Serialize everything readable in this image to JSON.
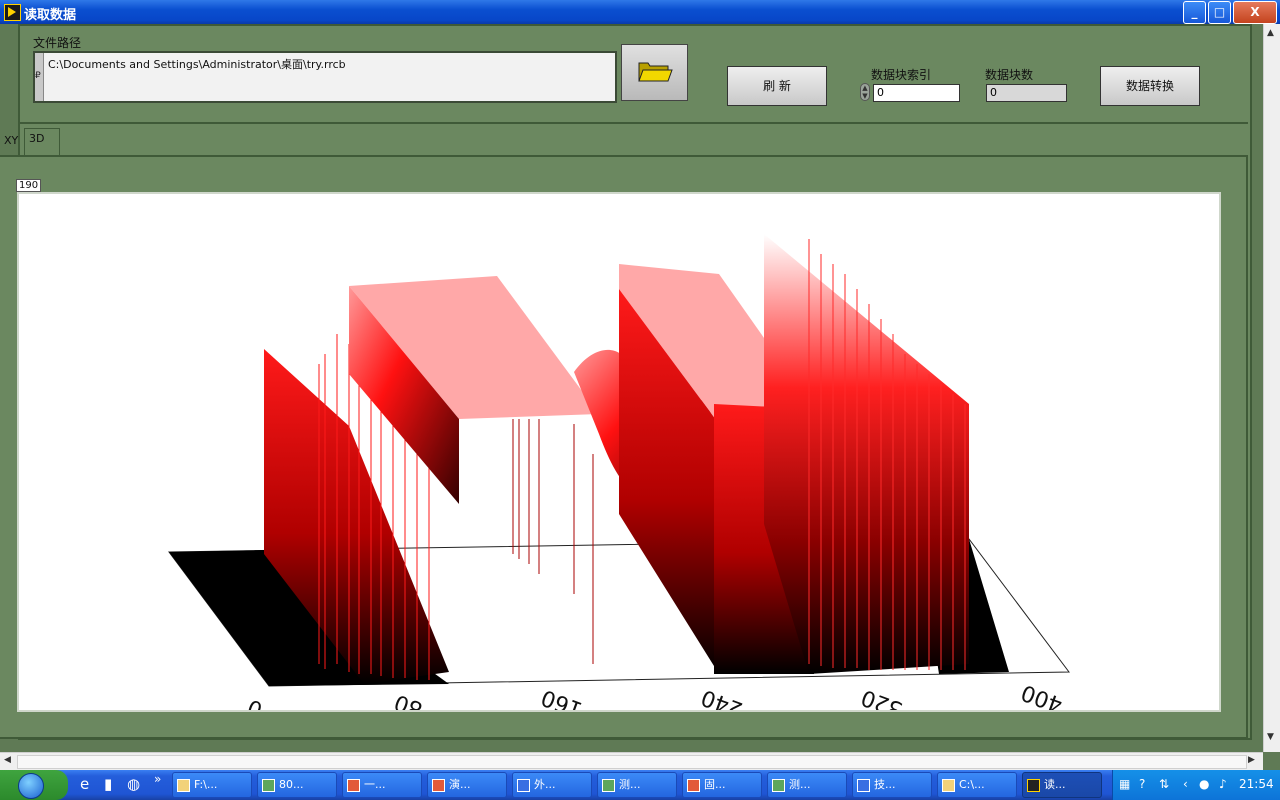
{
  "window": {
    "title": "读取数据",
    "controls": [
      "_",
      "□",
      "X"
    ]
  },
  "controls": {
    "file_path_label": "文件路径",
    "file_path_value": "C:\\Documents and Settings\\Administrator\\桌面\\try.rrcb",
    "path_strip_glyph": "₽",
    "refresh_label": "刷  新",
    "block_index_label": "数据块索引",
    "block_index_value": "0",
    "block_count_label": "数据块数",
    "block_count_value": "0",
    "convert_label": "数据转换"
  },
  "tabs": [
    {
      "label": "XY",
      "active": false
    },
    {
      "label": "3D",
      "active": true
    }
  ],
  "graph": {
    "label": "190",
    "axis_ticks": [
      "0",
      "80",
      "160",
      "240",
      "320",
      "400"
    ]
  },
  "colors": {
    "panel": "#6b8860",
    "surface_peak": "#ff0000",
    "surface_top": "#ffaaaa",
    "surface_base": "#000000"
  },
  "taskbar": {
    "quick_launch": [
      "ie-icon",
      "desktop-icon",
      "media-icon"
    ],
    "chevron": "»",
    "tasks": [
      {
        "label": "F:\\...",
        "icon": "folder-icon"
      },
      {
        "label": "80...",
        "icon": "doc-icon"
      },
      {
        "label": "一...",
        "icon": "ppt-icon"
      },
      {
        "label": "演...",
        "icon": "ppt-icon"
      },
      {
        "label": "外...",
        "icon": "word-icon"
      },
      {
        "label": "测...",
        "icon": "doc-icon"
      },
      {
        "label": "固...",
        "icon": "ppt-icon"
      },
      {
        "label": "测...",
        "icon": "doc-icon"
      },
      {
        "label": "技...",
        "icon": "word-icon"
      },
      {
        "label": "C:\\...",
        "icon": "folder-icon"
      },
      {
        "label": "读...",
        "icon": "labview-icon",
        "active": true
      }
    ],
    "clock": "21:54"
  }
}
